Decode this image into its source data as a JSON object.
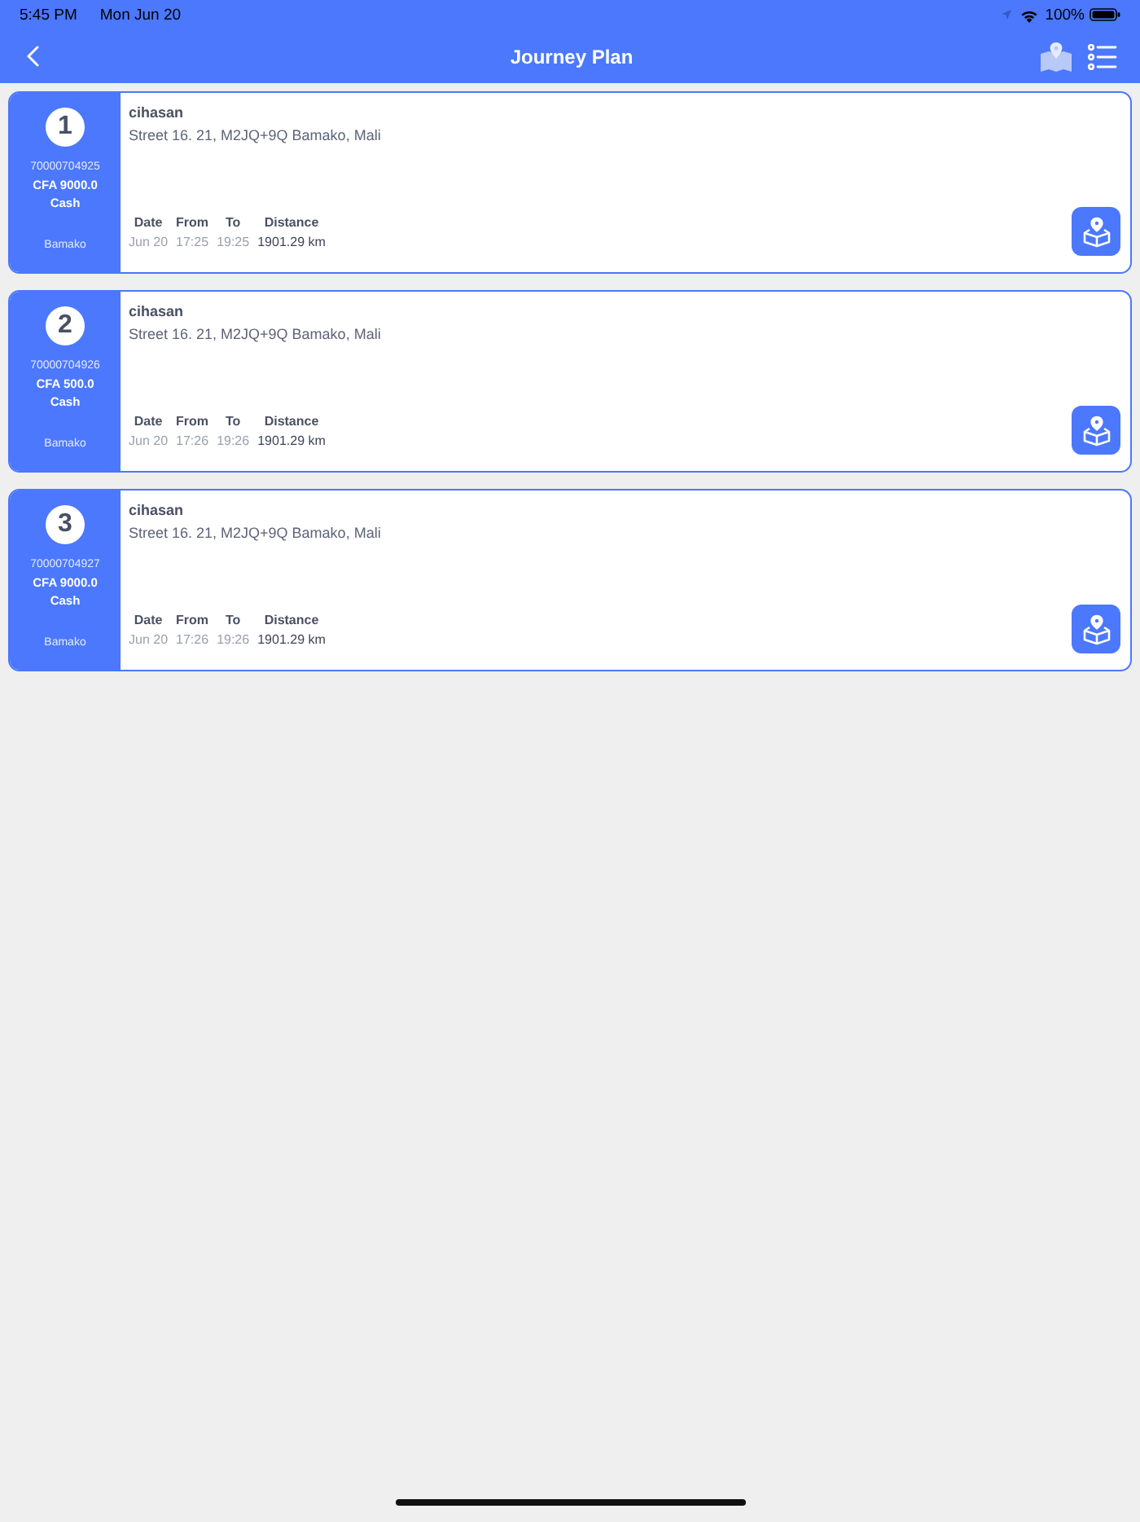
{
  "status_bar": {
    "time": "5:45 PM",
    "date": "Mon Jun 20",
    "battery": "100%"
  },
  "nav_bar": {
    "title": "Journey Plan"
  },
  "stops": [
    {
      "number": "1",
      "order_id": "70000704925",
      "amount": "CFA 9000.0",
      "payment": "Cash",
      "city": "Bamako",
      "customer": "cihasan",
      "address": "Street 16. 21, M2JQ+9Q Bamako, Mali",
      "fields": [
        {
          "kind": "schedule",
          "label": "Date",
          "value": "Jun 20"
        },
        {
          "kind": "schedule",
          "label": "From",
          "value": "17:25"
        },
        {
          "kind": "schedule",
          "label": "To",
          "value": "19:25"
        },
        {
          "kind": "distance",
          "label": "Distance",
          "value": "1901.29 km"
        }
      ]
    },
    {
      "number": "2",
      "order_id": "70000704926",
      "amount": "CFA 500.0",
      "payment": "Cash",
      "city": "Bamako",
      "customer": "cihasan",
      "address": "Street 16. 21, M2JQ+9Q Bamako, Mali",
      "fields": [
        {
          "kind": "schedule",
          "label": "Date",
          "value": "Jun 20"
        },
        {
          "kind": "schedule",
          "label": "From",
          "value": "17:26"
        },
        {
          "kind": "schedule",
          "label": "To",
          "value": "19:26"
        },
        {
          "kind": "distance",
          "label": "Distance",
          "value": "1901.29 km"
        }
      ]
    },
    {
      "number": "3",
      "order_id": "70000704927",
      "amount": "CFA 9000.0",
      "payment": "Cash",
      "city": "Bamako",
      "customer": "cihasan",
      "address": "Street 16. 21, M2JQ+9Q Bamako, Mali",
      "fields": [
        {
          "kind": "schedule",
          "label": "Date",
          "value": "Jun 20"
        },
        {
          "kind": "schedule",
          "label": "From",
          "value": "17:26"
        },
        {
          "kind": "schedule",
          "label": "To",
          "value": "19:26"
        },
        {
          "kind": "distance",
          "label": "Distance",
          "value": "1901.29 km"
        }
      ]
    }
  ]
}
